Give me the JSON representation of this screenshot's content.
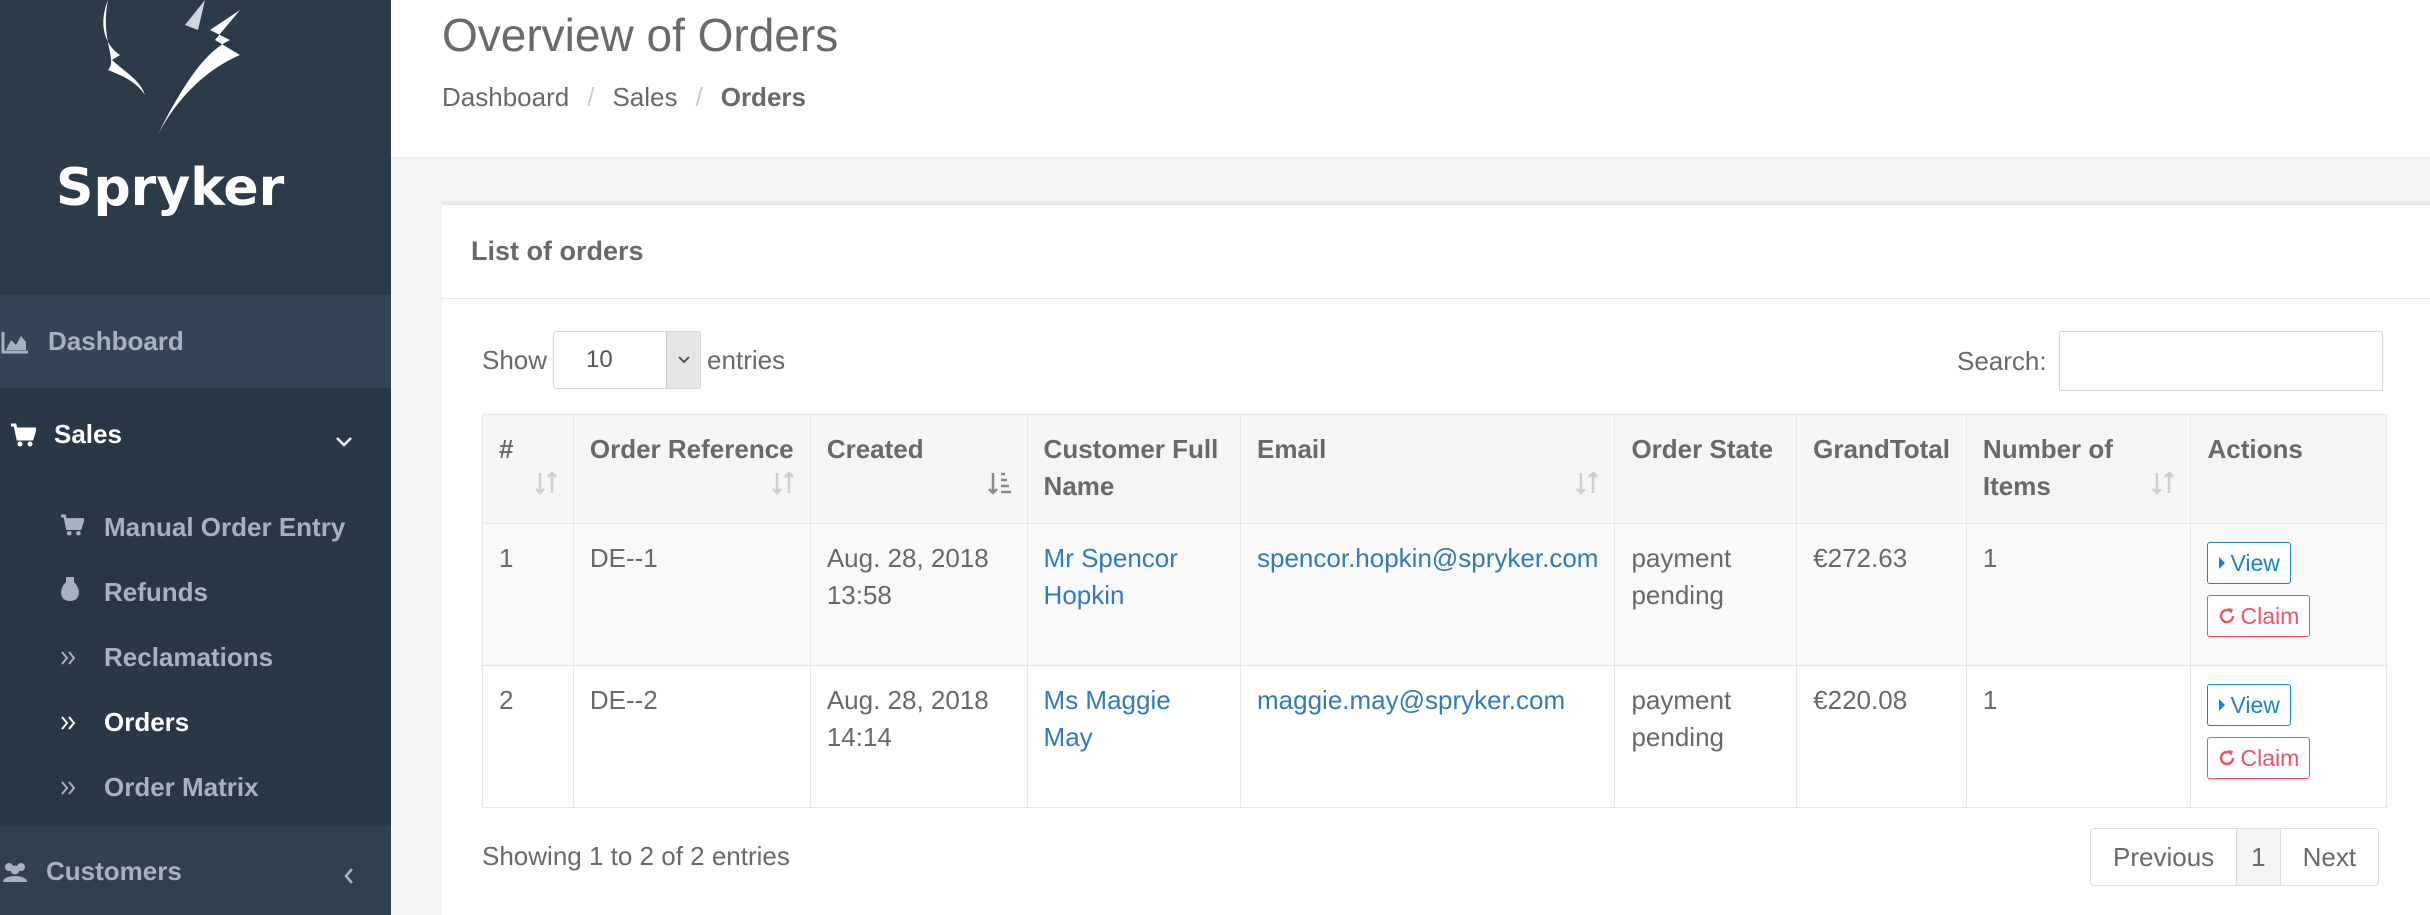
{
  "app": {
    "brand_name": "Spryker"
  },
  "sidebar": {
    "dashboard": {
      "label": "Dashboard",
      "icon": "area-chart-icon"
    },
    "sales": {
      "label": "Sales",
      "icon": "shopping-cart-icon",
      "expanded": true
    },
    "sales_items": [
      {
        "label": "Manual Order Entry",
        "icon": "shopping-cart-icon",
        "active": false
      },
      {
        "label": "Refunds",
        "icon": "money-bag-icon",
        "active": false
      },
      {
        "label": "Reclamations",
        "icon": "double-chevron-right-icon",
        "active": false
      },
      {
        "label": "Orders",
        "icon": "double-chevron-right-icon",
        "active": true
      },
      {
        "label": "Order Matrix",
        "icon": "double-chevron-right-icon",
        "active": false
      }
    ],
    "customers": {
      "label": "Customers",
      "icon": "users-icon",
      "expanded": false
    }
  },
  "header": {
    "title": "Overview of Orders",
    "breadcrumb": [
      "Dashboard",
      "Sales",
      "Orders"
    ]
  },
  "panel": {
    "title": "List of orders",
    "show_label": "Show",
    "entries_label": "entries",
    "page_length": "10",
    "search_label": "Search:",
    "search_value": ""
  },
  "table": {
    "columns": [
      "#",
      "Order Reference",
      "Created",
      "Customer Full Name",
      "Email",
      "Order State",
      "GrandTotal",
      "Number of Items",
      "Actions"
    ],
    "rows": [
      {
        "num": "1",
        "reference": "DE--1",
        "created": "Aug. 28, 2018 13:58",
        "customer": "Mr Spencor Hopkin",
        "email": "spencor.hopkin@spryker.com",
        "state": "payment pending",
        "total": "€272.63",
        "items": "1"
      },
      {
        "num": "2",
        "reference": "DE--2",
        "created": "Aug. 28, 2018 14:14",
        "customer": "Ms Maggie May",
        "email": "maggie.may@spryker.com",
        "state": "payment pending",
        "total": "€220.08",
        "items": "1"
      }
    ],
    "actions": {
      "view_label": "View",
      "claim_label": "Claim"
    }
  },
  "footer": {
    "info": "Showing 1 to 2 of 2 entries",
    "pager": {
      "previous": "Previous",
      "current": "1",
      "next": "Next"
    }
  },
  "colors": {
    "sidebar_bg": "#2f4050",
    "link": "#337ab7",
    "view_button": "#1c84c6",
    "claim_button": "#ed5565"
  }
}
